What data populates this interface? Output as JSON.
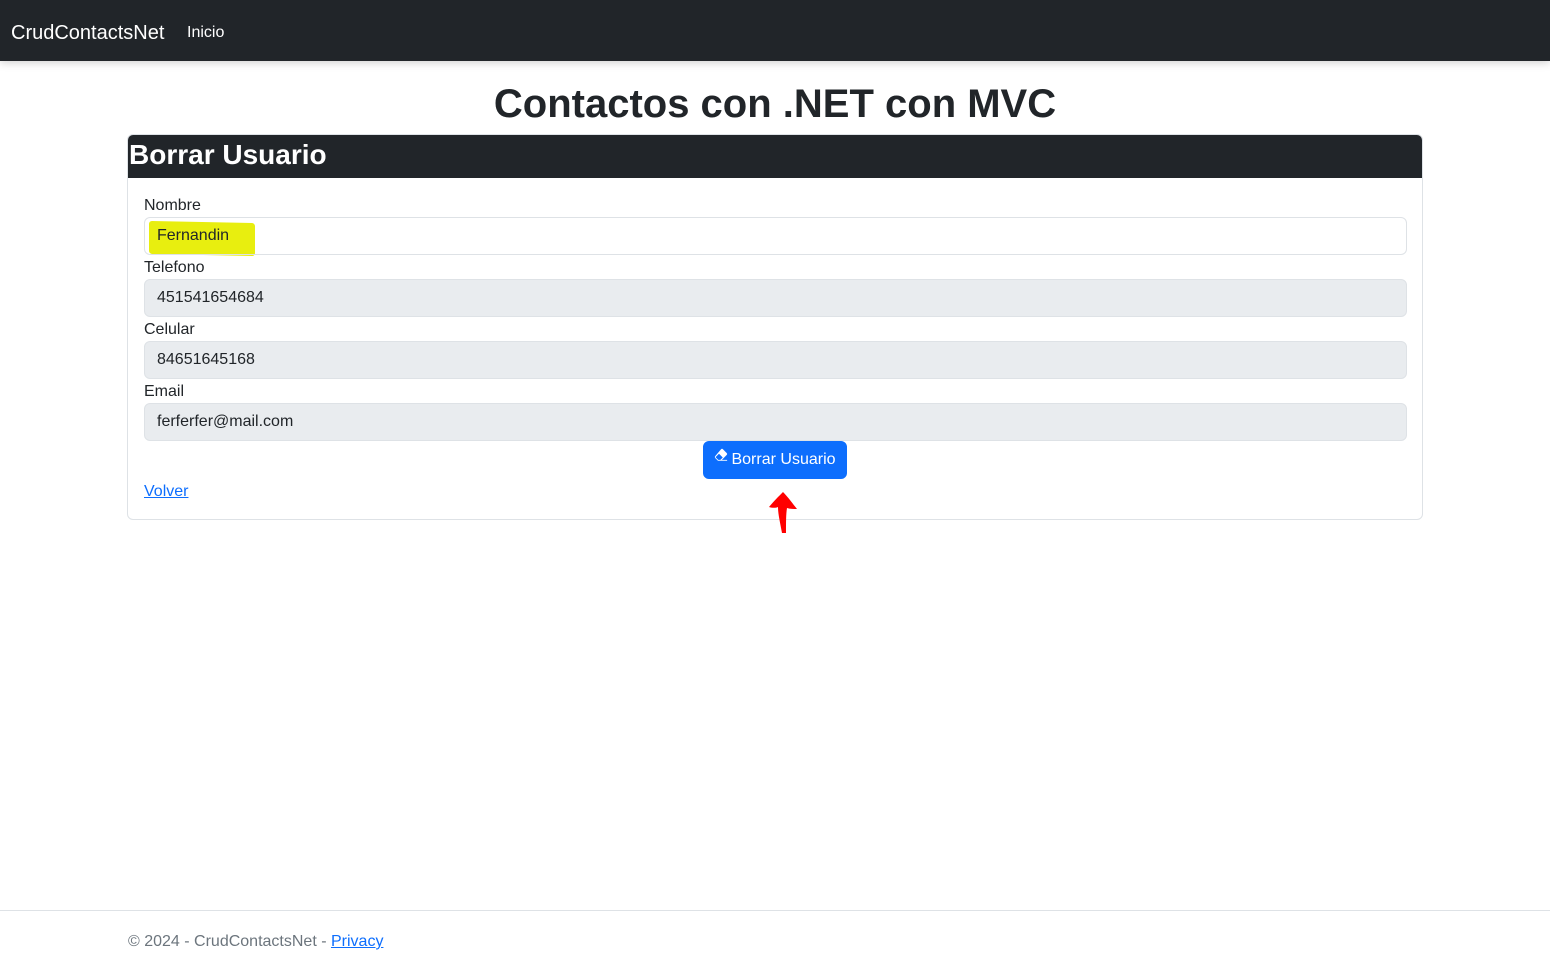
{
  "navbar": {
    "brand": "CrudContactsNet",
    "links": [
      {
        "label": "Inicio"
      }
    ]
  },
  "page": {
    "title": "Contactos con .NET con MVC"
  },
  "card": {
    "header": "Borrar Usuario",
    "fields": [
      {
        "label": "Nombre",
        "value": "Fernandin"
      },
      {
        "label": "Telefono",
        "value": "451541654684"
      },
      {
        "label": "Celular",
        "value": "84651645168"
      },
      {
        "label": "Email",
        "value": "ferferfer@mail.com"
      }
    ],
    "submit_label": "Borrar Usuario",
    "back_link": "Volver"
  },
  "footer": {
    "text": "© 2024 - CrudContactsNet - ",
    "privacy_link": "Privacy"
  },
  "colors": {
    "navbar_bg": "#212529",
    "primary": "#0d6efd",
    "input_bg": "#e9ecef",
    "highlight": "#e8ee0f",
    "annotation_arrow": "#ff0000"
  },
  "icons": {
    "submit_icon": "eraser-icon",
    "annotation": "red-arrow-up-icon"
  }
}
